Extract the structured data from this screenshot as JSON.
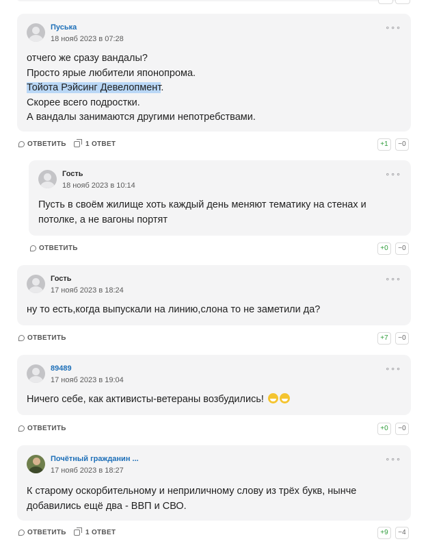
{
  "comments": [
    {
      "author": "Пуська",
      "date": "18 нояб 2023 в 07:28",
      "lines_before": "отчего же сразу вандалы?\nПросто ярые любители японопрома.\n",
      "highlight": "Тойота Рэйсинг Девелопмент",
      "lines_after": ".\nСкорее всего подростки.\nА вандалы занимаются другими непотребствами.",
      "reply_label": "ОТВЕТИТЬ",
      "thread_label": "1 ОТВЕТ",
      "votes_up": "+1",
      "votes_down": "−0"
    },
    {
      "author": "Гость",
      "date": "18 нояб 2023 в 10:14",
      "text": "Пусть в своём жилище хоть каждый день меняют тематику на стенах и\nпотолке, а не вагоны портят",
      "reply_label": "ОТВЕТИТЬ",
      "votes_up": "+0",
      "votes_down": "−0"
    },
    {
      "author": "Гость",
      "date": "17 нояб 2023 в 18:24",
      "text": "ну то есть,когда выпускали на линию,слона то не заметили да?",
      "reply_label": "ОТВЕТИТЬ",
      "votes_up": "+7",
      "votes_down": "−0"
    },
    {
      "author": "89489",
      "date": "17 нояб 2023 в 19:04",
      "text": "Ничего себе, как активисты-ветераны возбудились!",
      "emoji": "grinning-face-icon",
      "reply_label": "ОТВЕТИТЬ",
      "votes_up": "+0",
      "votes_down": "−0"
    },
    {
      "author": "Почётный гражданин ...",
      "date": "17 нояб 2023 в 18:27",
      "text": "К старому оскорбительному и неприличному слову из трёх букв, нынче\nдобавились ещё два - ВВП и СВО.",
      "reply_label": "ОТВЕТИТЬ",
      "thread_label": "1 ОТВЕТ",
      "votes_up": "+9",
      "votes_down": "−4"
    }
  ],
  "more_menu": "∘∘∘",
  "colors": {
    "author_link": "#1d6fb8",
    "vote_up": "#2e9c3a",
    "highlight": "#b9d7f6",
    "card_bg": "#f4f4f5"
  }
}
